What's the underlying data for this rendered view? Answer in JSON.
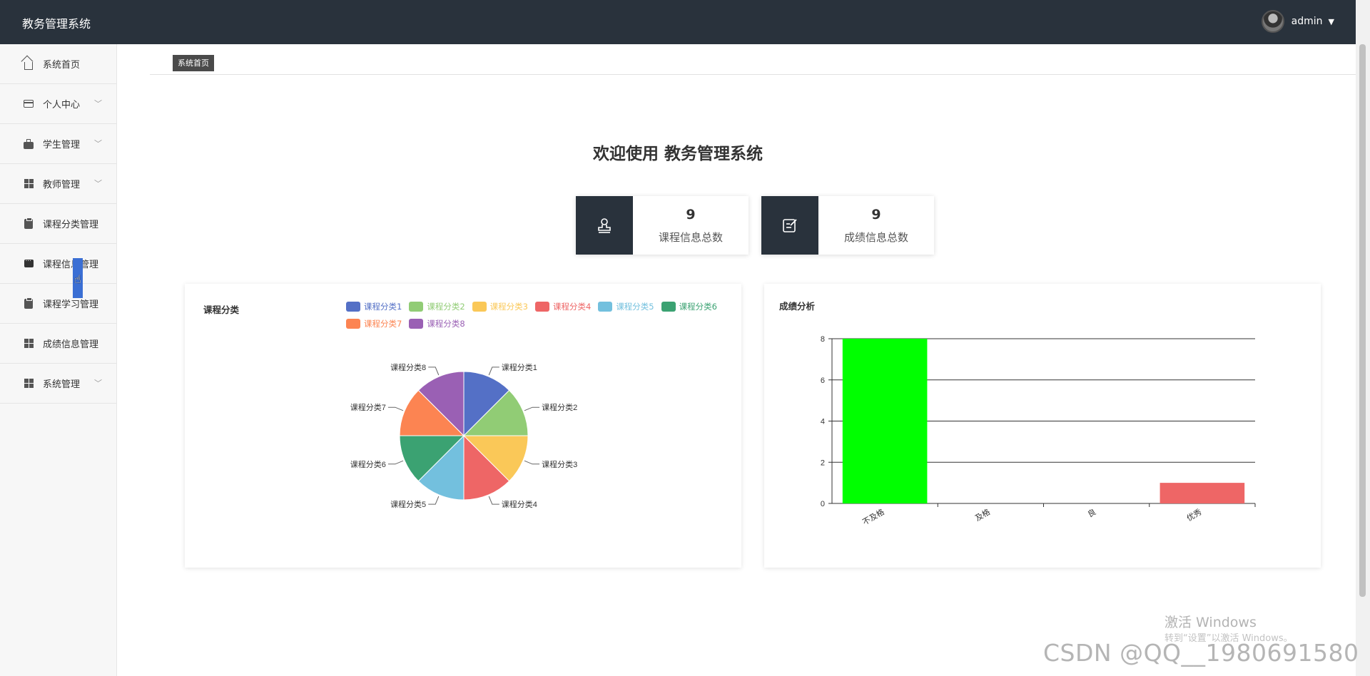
{
  "app": {
    "title": "教务管理系统",
    "user": "admin"
  },
  "sidebar": {
    "items": [
      {
        "label": "系统首页",
        "icon": "home-icon",
        "expandable": false
      },
      {
        "label": "个人中心",
        "icon": "id-card-icon",
        "expandable": true
      },
      {
        "label": "学生管理",
        "icon": "briefcase-icon",
        "expandable": true
      },
      {
        "label": "教师管理",
        "icon": "grid-icon",
        "expandable": true
      },
      {
        "label": "课程分类管理",
        "icon": "clipboard-check-icon",
        "expandable": false
      },
      {
        "label": "课程信息管理",
        "icon": "chat-icon",
        "expandable": false
      },
      {
        "label": "课程学习管理",
        "icon": "clipboard-icon",
        "expandable": false
      },
      {
        "label": "成绩信息管理",
        "icon": "grid-icon",
        "expandable": false
      },
      {
        "label": "系统管理",
        "icon": "grid-icon",
        "expandable": true
      }
    ]
  },
  "breadcrumb": {
    "current": "系统首页"
  },
  "welcome": "欢迎使用 教务管理系统",
  "stats": [
    {
      "value": "9",
      "label": "课程信息总数",
      "icon": "stamp-icon"
    },
    {
      "value": "9",
      "label": "成绩信息总数",
      "icon": "edit-icon"
    }
  ],
  "panels": {
    "pie_title": "课程分类",
    "bar_title": "成绩分析"
  },
  "chart_data": [
    {
      "type": "pie",
      "title": "课程分类",
      "categories": [
        "课程分类1",
        "课程分类2",
        "课程分类3",
        "课程分类4",
        "课程分类5",
        "课程分类6",
        "课程分类7",
        "课程分类8"
      ],
      "values": [
        1,
        1,
        1,
        1,
        1,
        1,
        1,
        1
      ],
      "colors": [
        "#5470c6",
        "#91cc75",
        "#fac858",
        "#ee6666",
        "#73c0de",
        "#3ba272",
        "#fc8452",
        "#9a60b4"
      ],
      "legend": "top"
    },
    {
      "type": "bar",
      "title": "成绩分析",
      "categories": [
        "不及格",
        "及格",
        "良",
        "优秀"
      ],
      "values": [
        8,
        0,
        0,
        1
      ],
      "colors": [
        "#00ff00",
        "#00ff00",
        "#00ff00",
        "#ee6666"
      ],
      "ylim": [
        0,
        8
      ],
      "yticks": [
        0,
        2,
        4,
        6,
        8
      ],
      "grid": true
    }
  ],
  "watermark": {
    "windows_title": "激活 Windows",
    "windows_sub": "转到“设置”以激活 Windows。",
    "csdn": "CSDN @QQ__1980691580"
  }
}
